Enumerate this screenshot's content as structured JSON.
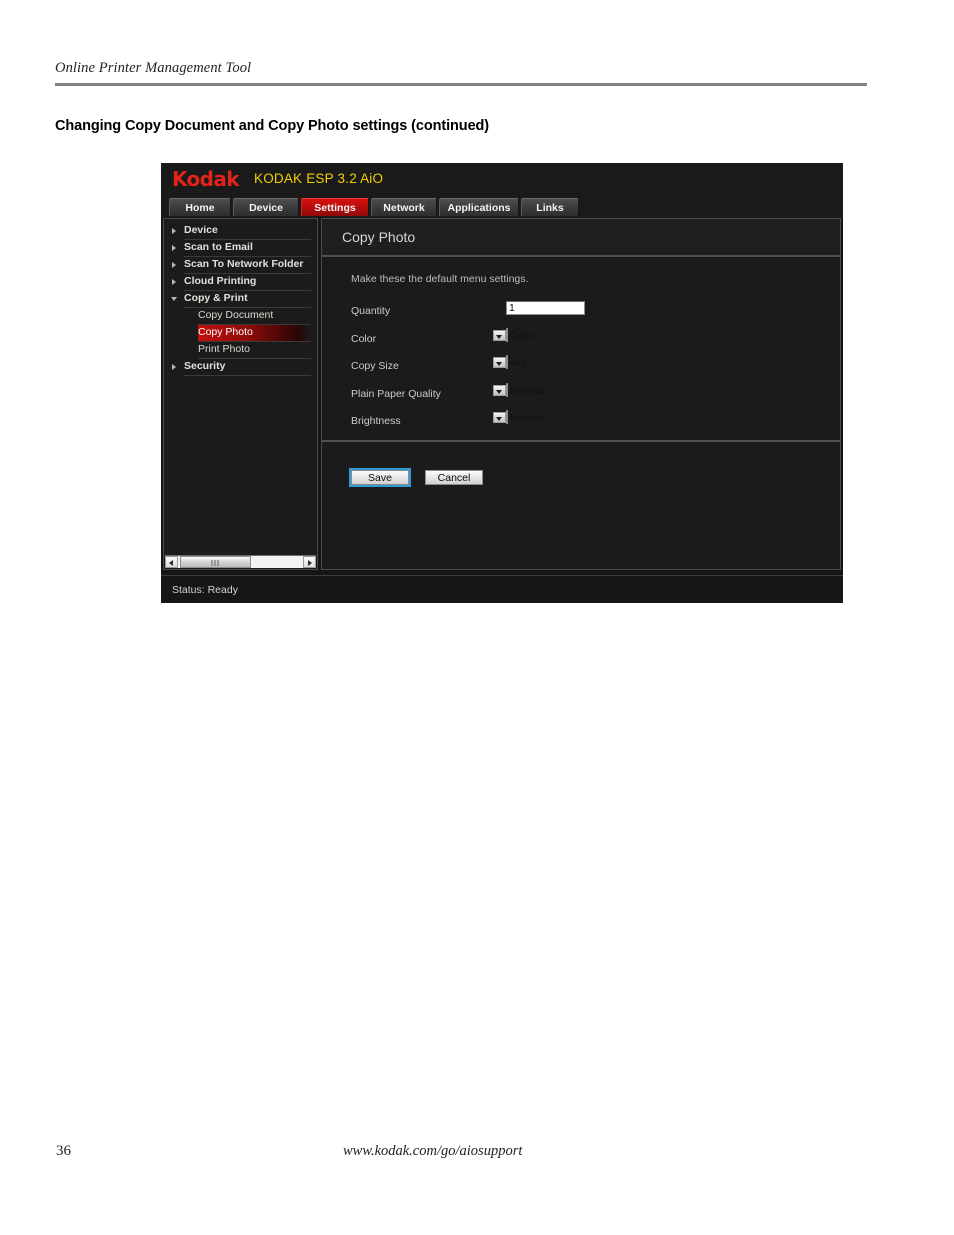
{
  "document": {
    "header": "Online Printer Management Tool",
    "title": "Changing Copy Document and Copy Photo settings (continued)",
    "page_number": "36",
    "footer_url": "www.kodak.com/go/aiosupport"
  },
  "app": {
    "brand_logo": "Kodak",
    "model": "KODAK ESP 3.2 AiO",
    "brand_color": "#e2231a",
    "model_color": "#f2d000",
    "accent_color": "#c2100f",
    "tabs": [
      {
        "label": "Home",
        "active": false
      },
      {
        "label": "Device",
        "active": false
      },
      {
        "label": "Settings",
        "active": true
      },
      {
        "label": "Network",
        "active": false
      },
      {
        "label": "Applications",
        "active": false
      },
      {
        "label": "Links",
        "active": false
      }
    ],
    "sidebar": {
      "items": [
        {
          "label": "Device",
          "type": "group",
          "expanded": false,
          "selected": false
        },
        {
          "label": "Scan to Email",
          "type": "group",
          "expanded": false,
          "selected": false
        },
        {
          "label": "Scan To Network Folder",
          "type": "group",
          "expanded": false,
          "selected": false
        },
        {
          "label": "Cloud Printing",
          "type": "group",
          "expanded": false,
          "selected": false
        },
        {
          "label": "Copy & Print",
          "type": "group",
          "expanded": true,
          "selected": false
        },
        {
          "label": "Copy Document",
          "type": "subitem",
          "expanded": false,
          "selected": false
        },
        {
          "label": "Copy Photo",
          "type": "subitem",
          "expanded": false,
          "selected": true
        },
        {
          "label": "Print Photo",
          "type": "subitem",
          "expanded": false,
          "selected": false
        },
        {
          "label": "Security",
          "type": "group",
          "expanded": false,
          "selected": false
        }
      ]
    },
    "content": {
      "title": "Copy Photo",
      "note": "Make these the default menu settings.",
      "fields": [
        {
          "label": "Quantity",
          "control": "text",
          "value": "1"
        },
        {
          "label": "Color",
          "control": "select",
          "value": "Color"
        },
        {
          "label": "Copy Size",
          "control": "select",
          "value": "4x6"
        },
        {
          "label": "Plain Paper Quality",
          "control": "select",
          "value": "Normal"
        },
        {
          "label": "Brightness",
          "control": "select",
          "value": "Normal"
        }
      ],
      "buttons": {
        "save": "Save",
        "cancel": "Cancel"
      }
    },
    "status": "Status: Ready"
  }
}
